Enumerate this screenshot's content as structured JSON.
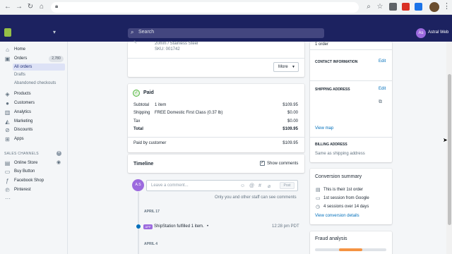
{
  "browser": {
    "icons": [
      "back-icon",
      "forward-icon",
      "reload-icon",
      "home-icon",
      "lock-icon",
      "search-icon",
      "star-icon"
    ]
  },
  "topbar": {
    "search_placeholder": "Search",
    "avatar_initials": "As",
    "store_name": "Astral Web"
  },
  "sidebar": {
    "home": "Home",
    "orders": "Orders",
    "orders_count": "2,780",
    "all_orders": "All orders",
    "drafts": "Drafts",
    "abandoned": "Abandoned checkouts",
    "products": "Products",
    "customers": "Customers",
    "analytics": "Analytics",
    "marketing": "Marketing",
    "discounts": "Discounts",
    "apps": "Apps",
    "sales_channels": "SALES CHANNELS",
    "online_store": "Online Store",
    "buy_button": "Buy Button",
    "facebook_shop": "Facebook Shop",
    "pinterest": "Pinterest",
    "more": "···"
  },
  "item_card": {
    "variant": "20mm / Stainless Steel",
    "sku": "SKU: 001742",
    "more_label": "More"
  },
  "paid_card": {
    "title": "Paid",
    "rows": [
      {
        "label": "Subtotal",
        "detail": "1 item",
        "amount": "$109.95"
      },
      {
        "label": "Shipping",
        "detail": "FREE Domestic First Class (0.37 lb)",
        "amount": "$0.00"
      },
      {
        "label": "Tax",
        "detail": "",
        "amount": "$0.00"
      },
      {
        "label": "Total",
        "detail": "",
        "amount": "$109.95"
      }
    ],
    "paid_by_label": "Paid by customer",
    "paid_by_amount": "$109.95"
  },
  "timeline": {
    "title": "Timeline",
    "show_comments": "Show comments",
    "avatar_initials": "A.S",
    "comment_placeholder": "Leave a comment...",
    "post_label": "Post",
    "note": "Only you and other staff can see comments",
    "date1": "APRIL 17",
    "event_tag": "APP",
    "event_text": "ShipStation fulfilled 1 item.",
    "event_bullet": "•",
    "event_time": "12:28 pm PDT",
    "date2": "APRIL 4"
  },
  "customer_card": {
    "orders_count": "1 order",
    "contact_title": "CONTACT INFORMATION",
    "contact_edit": "Edit",
    "shipping_title": "SHIPPING ADDRESS",
    "shipping_edit": "Edit",
    "view_map": "View map",
    "billing_title": "BILLING ADDRESS",
    "billing_text": "Same as shipping address"
  },
  "conversion": {
    "title": "Conversion summary",
    "items": [
      "This is their 1st order",
      "1st session from Google",
      "4 sessions over 14 days"
    ],
    "link": "View conversion details"
  },
  "fraud": {
    "title": "Fraud analysis",
    "level_fraction": 0.33
  },
  "colors": {
    "nav": "#1c2260",
    "link": "#006fbb",
    "paid_green": "#50b83c",
    "fraud_orange": "#f49342",
    "avatar_purple": "#9c6ade"
  }
}
